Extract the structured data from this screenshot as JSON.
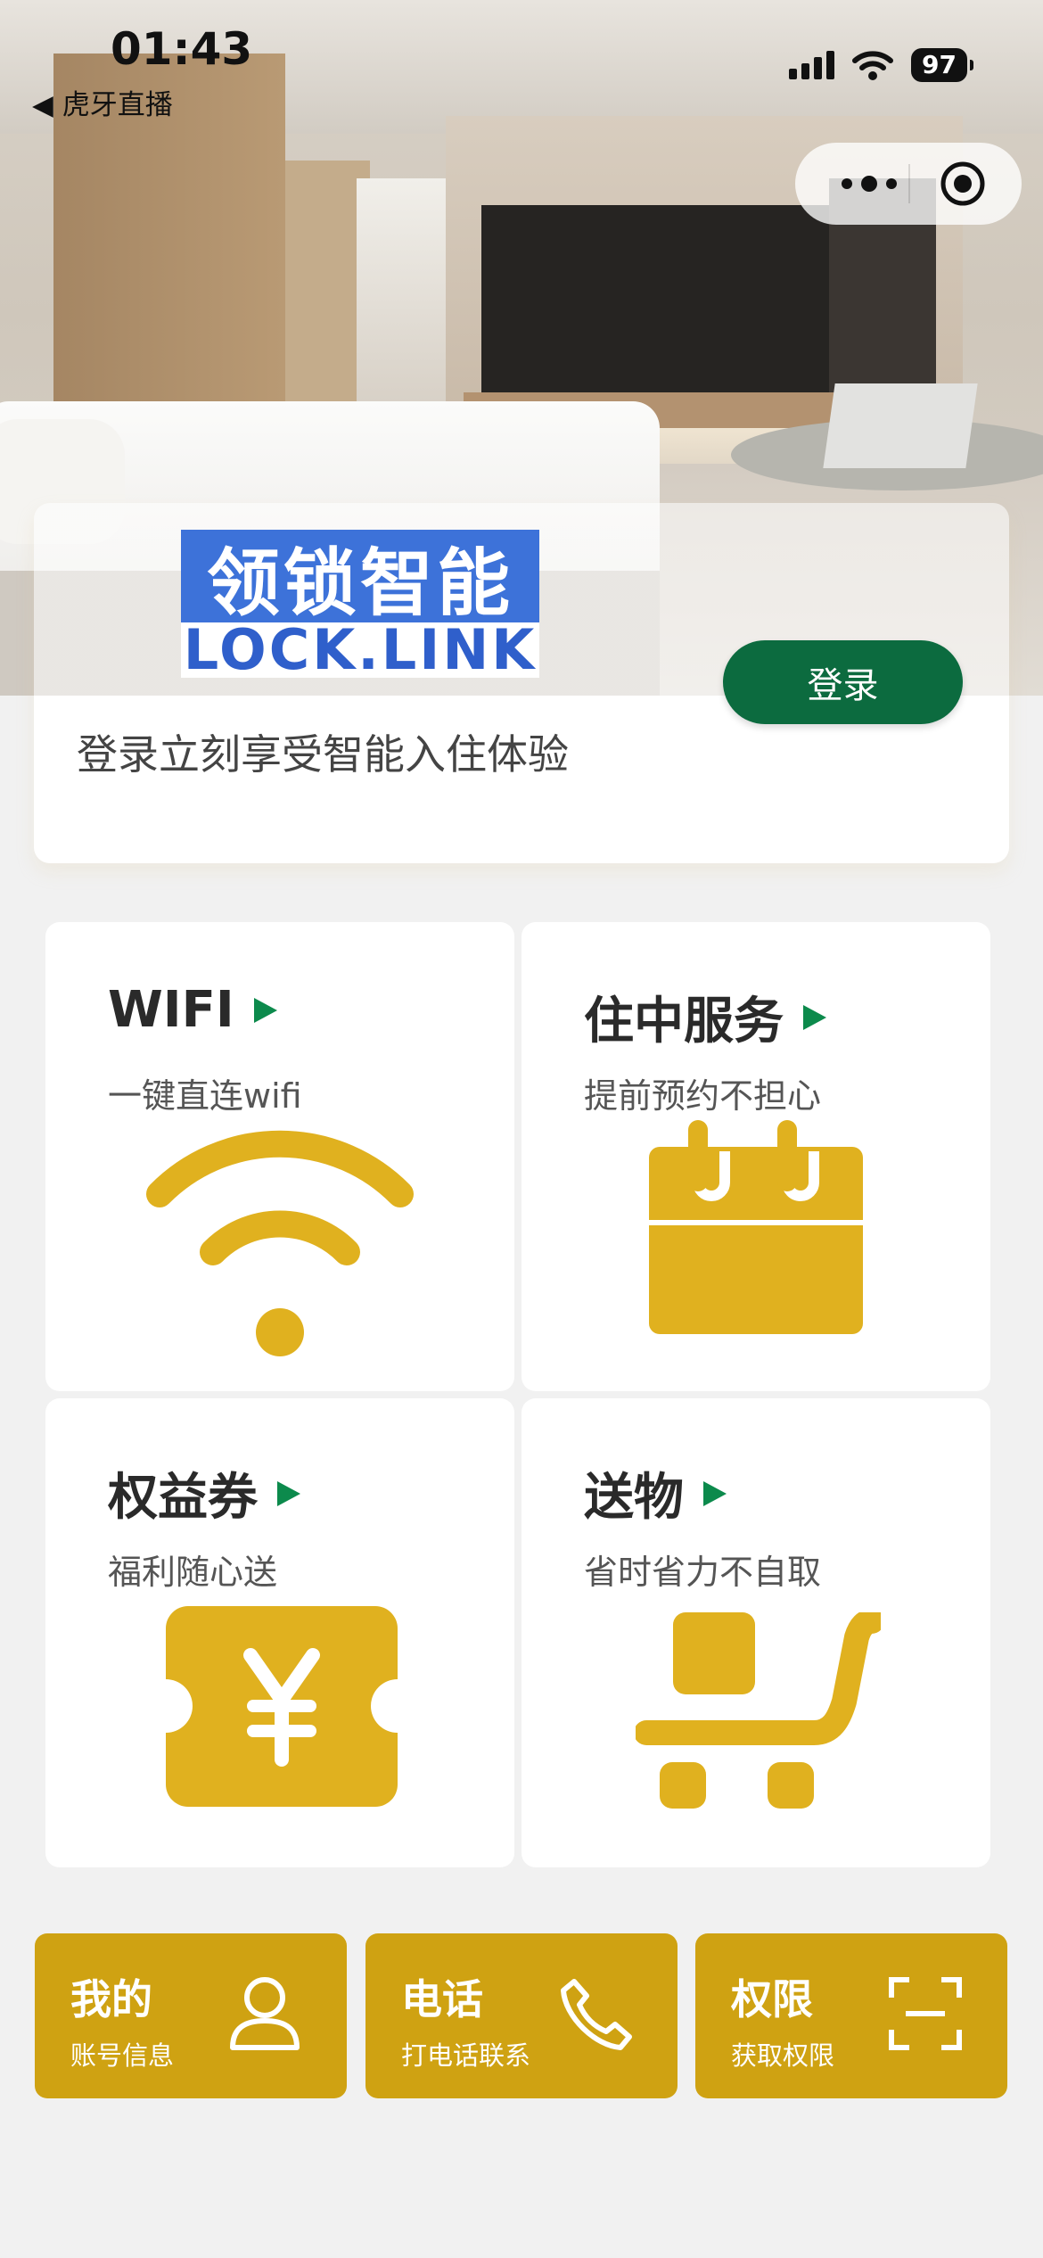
{
  "status_bar": {
    "time": "01:43",
    "back_app": "◀ 虎牙直播",
    "battery": "97"
  },
  "brand": {
    "logo_cn": "领锁智能",
    "logo_en": "LOCK.LINK"
  },
  "login": {
    "button_label": "登录",
    "tip": "登录立刻享受智能入住体验"
  },
  "cards": [
    {
      "title": "WIFI",
      "subtitle": "一键直连wifi",
      "icon": "wifi-icon"
    },
    {
      "title": "住中服务",
      "subtitle": "提前预约不担心",
      "icon": "calendar-icon"
    },
    {
      "title": "权益券",
      "subtitle": "福利随心送",
      "icon": "coupon-icon"
    },
    {
      "title": "送物",
      "subtitle": "省时省力不自取",
      "icon": "cart-icon"
    }
  ],
  "quick_buttons": [
    {
      "title": "我的",
      "subtitle": "账号信息",
      "icon": "user-icon"
    },
    {
      "title": "电话",
      "subtitle": "打电话联系",
      "icon": "phone-icon"
    },
    {
      "title": "权限",
      "subtitle": "获取权限",
      "icon": "scan-icon"
    }
  ],
  "colors": {
    "accent_gold": "#e0b11f",
    "button_gold": "#cfa212",
    "brand_green": "#0c6b3f",
    "arrow_green": "#0c8a4c"
  }
}
